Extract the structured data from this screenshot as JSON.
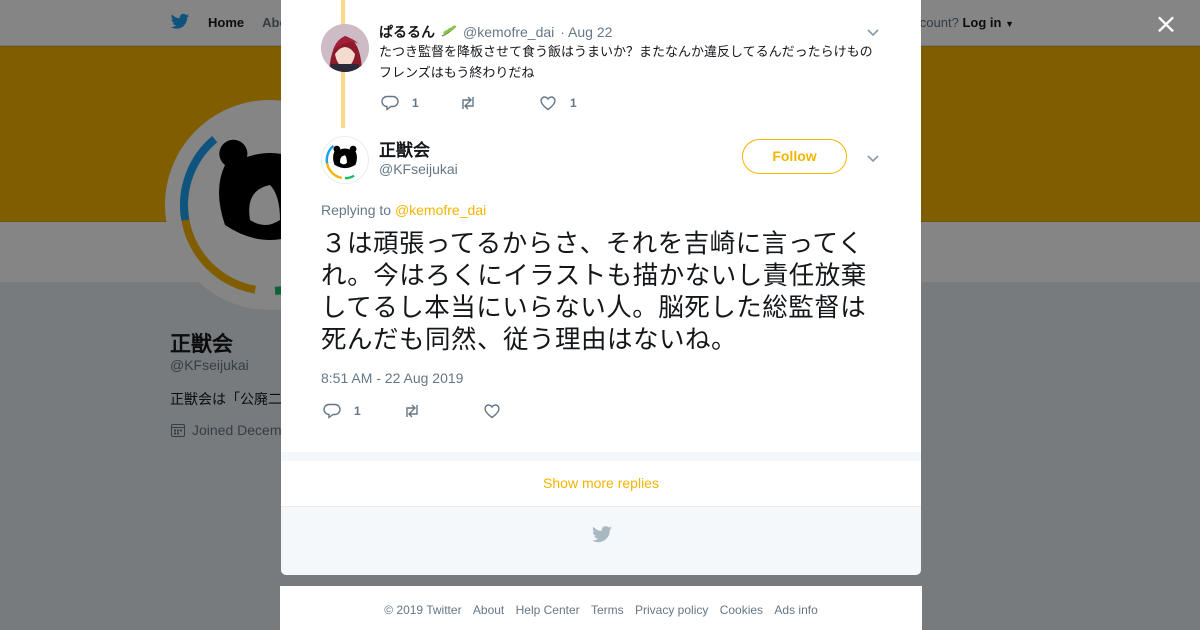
{
  "background": {
    "nav": {
      "home_label": "Home",
      "about_label_partial": "Abo"
    },
    "login": {
      "prompt_partial": "ccount?",
      "login_label": "Log in"
    },
    "profile": {
      "name": "正獣会",
      "handle": "@KFseijukai",
      "bio_partial": "正獣会は「公廃二",
      "joined_partial": "Joined Decem"
    }
  },
  "modal": {
    "close_label": "×",
    "reply": {
      "name": "ぱるるん",
      "handle": "@kemofre_dai",
      "date": "· Aug 22",
      "text": "たつき監督を降板させて食う飯はうまいか？またなんか違反してるんだったらけものフレンズはもう終わりだね",
      "reply_count": "1",
      "like_count": "1"
    },
    "main": {
      "name": "正獣会",
      "handle": "@KFseijukai",
      "follow_label": "Follow",
      "replying_prefix": "Replying to",
      "replying_to": "@kemofre_dai",
      "text": "３は頑張ってるからさ、それを吉崎に言ってくれ。今はろくにイラストも描かないし責任放棄してるし本当にいらない人。脳死した総監督は死んだも同然、従う理由はないね。",
      "timestamp": "8:51 AM - 22 Aug 2019",
      "reply_count": "1"
    },
    "show_more_label": "Show more replies"
  },
  "footer": {
    "copyright": "© 2019 Twitter",
    "links": [
      "About",
      "Help Center",
      "Terms",
      "Privacy policy",
      "Cookies",
      "Ads info"
    ]
  },
  "colors": {
    "accent": "#f5b400",
    "text": "#14171a",
    "muted": "#657786",
    "twitter_blue": "#1da1f2"
  }
}
